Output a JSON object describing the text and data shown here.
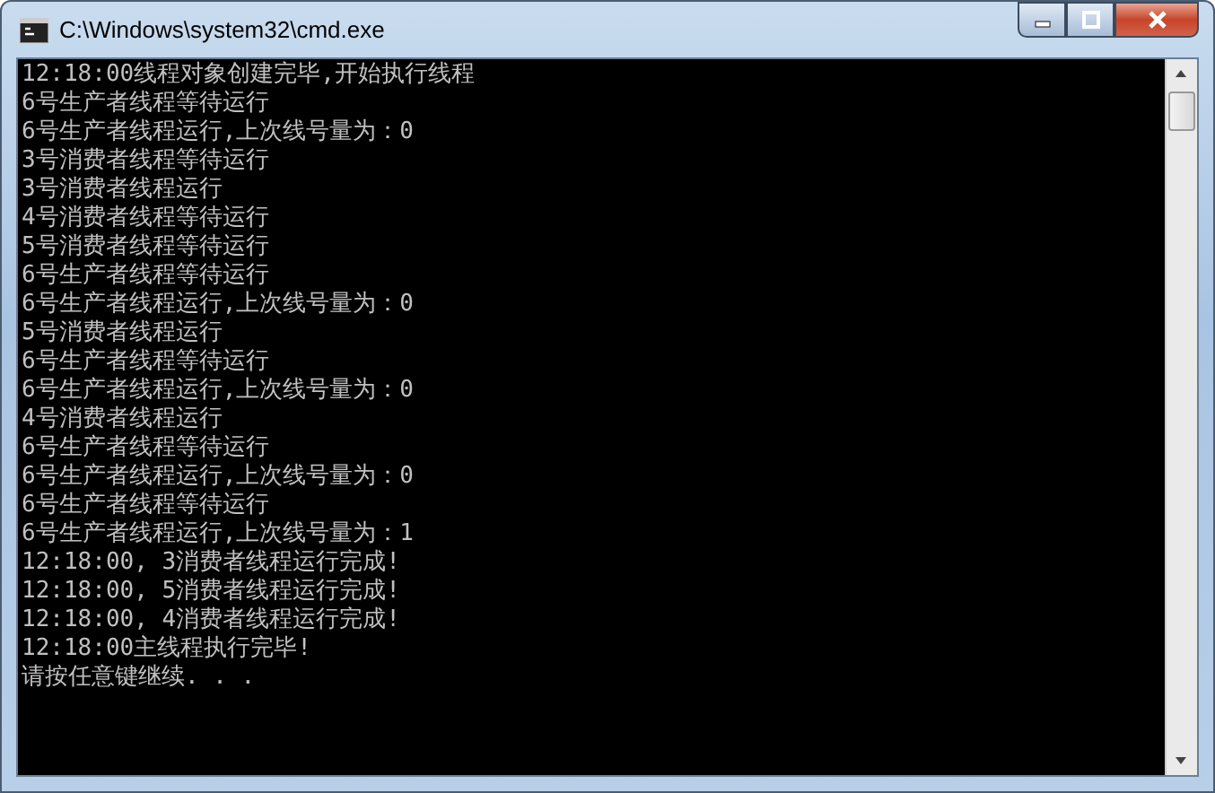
{
  "window": {
    "title": "C:\\Windows\\system32\\cmd.exe"
  },
  "console": {
    "lines": [
      "12:18:00线程对象创建完毕,开始执行线程",
      "6号生产者线程等待运行",
      "6号生产者线程运行,上次线号量为：0",
      "3号消费者线程等待运行",
      "3号消费者线程运行",
      "4号消费者线程等待运行",
      "5号消费者线程等待运行",
      "6号生产者线程等待运行",
      "6号生产者线程运行,上次线号量为：0",
      "5号消费者线程运行",
      "6号生产者线程等待运行",
      "6号生产者线程运行,上次线号量为：0",
      "4号消费者线程运行",
      "6号生产者线程等待运行",
      "6号生产者线程运行,上次线号量为：0",
      "6号生产者线程等待运行",
      "6号生产者线程运行,上次线号量为：1",
      "12:18:00, 3消费者线程运行完成!",
      "12:18:00, 5消费者线程运行完成!",
      "12:18:00, 4消费者线程运行完成!",
      "12:18:00主线程执行完毕!",
      "请按任意键继续. . ."
    ]
  }
}
